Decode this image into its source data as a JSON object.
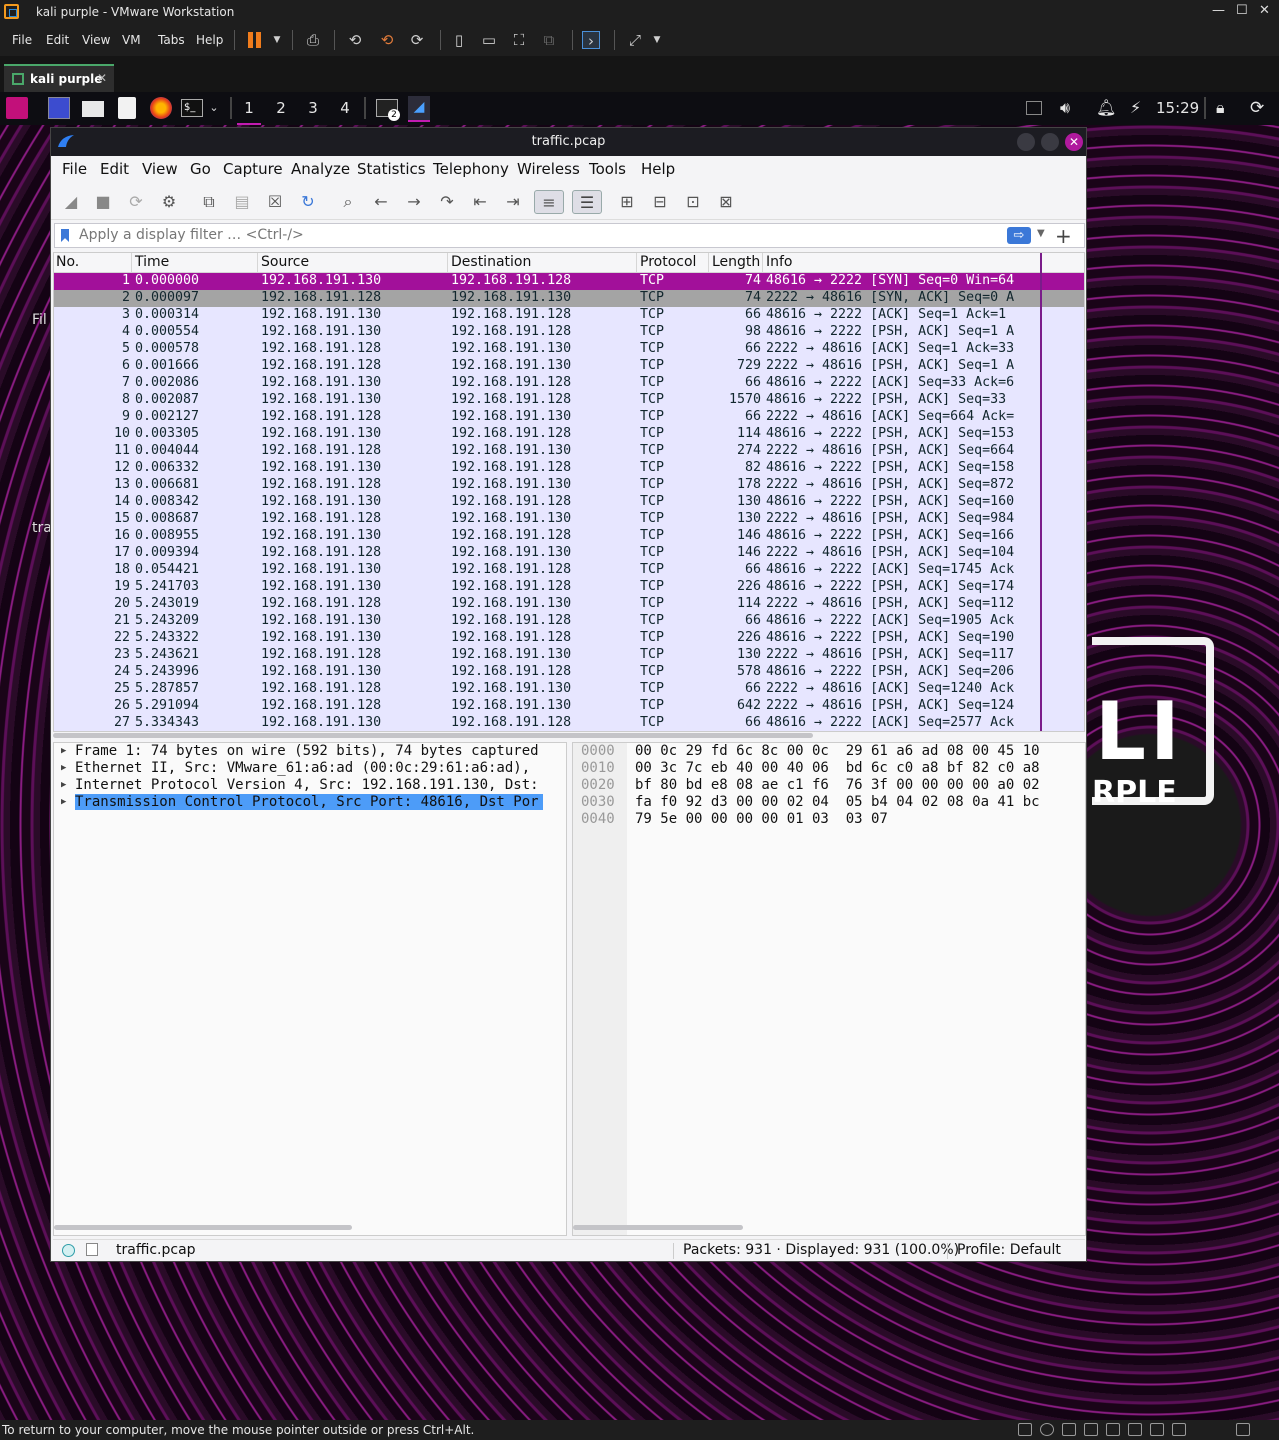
{
  "vm": {
    "title": "kali purple - VMware Workstation",
    "menu": [
      "File",
      "Edit",
      "View",
      "VM",
      "Tabs",
      "Help"
    ],
    "tab_label": "kali purple",
    "status_message": "To return to your computer, move the mouse pointer outside or press Ctrl+Alt."
  },
  "kali_panel": {
    "workspaces": [
      "1",
      "2",
      "3",
      "4"
    ],
    "terminal_badge": "2",
    "clock": "15:29"
  },
  "desktop": {
    "label_1": "Fil",
    "label_2": "tra",
    "logo_fragment": "LI",
    "logo_subtext": "RPLE"
  },
  "wireshark": {
    "title": "traffic.pcap",
    "menu": [
      "File",
      "Edit",
      "View",
      "Go",
      "Capture",
      "Analyze",
      "Statistics",
      "Telephony",
      "Wireless",
      "Tools",
      "Help"
    ],
    "filter_placeholder": "Apply a display filter … <Ctrl-/>",
    "columns": [
      "No.",
      "Time",
      "Source",
      "Destination",
      "Protocol",
      "Length",
      "Info"
    ],
    "packets": [
      {
        "no": "1",
        "time": "0.000000",
        "src": "192.168.191.130",
        "dst": "192.168.191.128",
        "proto": "TCP",
        "len": "74",
        "info": "48616 → 2222 [SYN] Seq=0 Win=64"
      },
      {
        "no": "2",
        "time": "0.000097",
        "src": "192.168.191.128",
        "dst": "192.168.191.130",
        "proto": "TCP",
        "len": "74",
        "info": "2222 → 48616 [SYN, ACK] Seq=0 A"
      },
      {
        "no": "3",
        "time": "0.000314",
        "src": "192.168.191.130",
        "dst": "192.168.191.128",
        "proto": "TCP",
        "len": "66",
        "info": "48616 → 2222 [ACK] Seq=1 Ack=1"
      },
      {
        "no": "4",
        "time": "0.000554",
        "src": "192.168.191.130",
        "dst": "192.168.191.128",
        "proto": "TCP",
        "len": "98",
        "info": "48616 → 2222 [PSH, ACK] Seq=1 A"
      },
      {
        "no": "5",
        "time": "0.000578",
        "src": "192.168.191.128",
        "dst": "192.168.191.130",
        "proto": "TCP",
        "len": "66",
        "info": "2222 → 48616 [ACK] Seq=1 Ack=33"
      },
      {
        "no": "6",
        "time": "0.001666",
        "src": "192.168.191.128",
        "dst": "192.168.191.130",
        "proto": "TCP",
        "len": "729",
        "info": "2222 → 48616 [PSH, ACK] Seq=1 A"
      },
      {
        "no": "7",
        "time": "0.002086",
        "src": "192.168.191.130",
        "dst": "192.168.191.128",
        "proto": "TCP",
        "len": "66",
        "info": "48616 → 2222 [ACK] Seq=33 Ack=6"
      },
      {
        "no": "8",
        "time": "0.002087",
        "src": "192.168.191.130",
        "dst": "192.168.191.128",
        "proto": "TCP",
        "len": "1570",
        "info": "48616 → 2222 [PSH, ACK] Seq=33"
      },
      {
        "no": "9",
        "time": "0.002127",
        "src": "192.168.191.128",
        "dst": "192.168.191.130",
        "proto": "TCP",
        "len": "66",
        "info": "2222 → 48616 [ACK] Seq=664 Ack="
      },
      {
        "no": "10",
        "time": "0.003305",
        "src": "192.168.191.130",
        "dst": "192.168.191.128",
        "proto": "TCP",
        "len": "114",
        "info": "48616 → 2222 [PSH, ACK] Seq=153"
      },
      {
        "no": "11",
        "time": "0.004044",
        "src": "192.168.191.128",
        "dst": "192.168.191.130",
        "proto": "TCP",
        "len": "274",
        "info": "2222 → 48616 [PSH, ACK] Seq=664"
      },
      {
        "no": "12",
        "time": "0.006332",
        "src": "192.168.191.130",
        "dst": "192.168.191.128",
        "proto": "TCP",
        "len": "82",
        "info": "48616 → 2222 [PSH, ACK] Seq=158"
      },
      {
        "no": "13",
        "time": "0.006681",
        "src": "192.168.191.128",
        "dst": "192.168.191.130",
        "proto": "TCP",
        "len": "178",
        "info": "2222 → 48616 [PSH, ACK] Seq=872"
      },
      {
        "no": "14",
        "time": "0.008342",
        "src": "192.168.191.130",
        "dst": "192.168.191.128",
        "proto": "TCP",
        "len": "130",
        "info": "48616 → 2222 [PSH, ACK] Seq=160"
      },
      {
        "no": "15",
        "time": "0.008687",
        "src": "192.168.191.128",
        "dst": "192.168.191.130",
        "proto": "TCP",
        "len": "130",
        "info": "2222 → 48616 [PSH, ACK] Seq=984"
      },
      {
        "no": "16",
        "time": "0.008955",
        "src": "192.168.191.130",
        "dst": "192.168.191.128",
        "proto": "TCP",
        "len": "146",
        "info": "48616 → 2222 [PSH, ACK] Seq=166"
      },
      {
        "no": "17",
        "time": "0.009394",
        "src": "192.168.191.128",
        "dst": "192.168.191.130",
        "proto": "TCP",
        "len": "146",
        "info": "2222 → 48616 [PSH, ACK] Seq=104"
      },
      {
        "no": "18",
        "time": "0.054421",
        "src": "192.168.191.130",
        "dst": "192.168.191.128",
        "proto": "TCP",
        "len": "66",
        "info": "48616 → 2222 [ACK] Seq=1745 Ack"
      },
      {
        "no": "19",
        "time": "5.241703",
        "src": "192.168.191.130",
        "dst": "192.168.191.128",
        "proto": "TCP",
        "len": "226",
        "info": "48616 → 2222 [PSH, ACK] Seq=174"
      },
      {
        "no": "20",
        "time": "5.243019",
        "src": "192.168.191.128",
        "dst": "192.168.191.130",
        "proto": "TCP",
        "len": "114",
        "info": "2222 → 48616 [PSH, ACK] Seq=112"
      },
      {
        "no": "21",
        "time": "5.243209",
        "src": "192.168.191.130",
        "dst": "192.168.191.128",
        "proto": "TCP",
        "len": "66",
        "info": "48616 → 2222 [ACK] Seq=1905 Ack"
      },
      {
        "no": "22",
        "time": "5.243322",
        "src": "192.168.191.130",
        "dst": "192.168.191.128",
        "proto": "TCP",
        "len": "226",
        "info": "48616 → 2222 [PSH, ACK] Seq=190"
      },
      {
        "no": "23",
        "time": "5.243621",
        "src": "192.168.191.128",
        "dst": "192.168.191.130",
        "proto": "TCP",
        "len": "130",
        "info": "2222 → 48616 [PSH, ACK] Seq=117"
      },
      {
        "no": "24",
        "time": "5.243996",
        "src": "192.168.191.130",
        "dst": "192.168.191.128",
        "proto": "TCP",
        "len": "578",
        "info": "48616 → 2222 [PSH, ACK] Seq=206"
      },
      {
        "no": "25",
        "time": "5.287857",
        "src": "192.168.191.128",
        "dst": "192.168.191.130",
        "proto": "TCP",
        "len": "66",
        "info": "2222 → 48616 [ACK] Seq=1240 Ack"
      },
      {
        "no": "26",
        "time": "5.291094",
        "src": "192.168.191.128",
        "dst": "192.168.191.130",
        "proto": "TCP",
        "len": "642",
        "info": "2222 → 48616 [PSH, ACK] Seq=124"
      },
      {
        "no": "27",
        "time": "5.334343",
        "src": "192.168.191.130",
        "dst": "192.168.191.128",
        "proto": "TCP",
        "len": "66",
        "info": "48616 → 2222 [ACK] Seq=2577 Ack"
      }
    ],
    "details": [
      "Frame 1: 74 bytes on wire (592 bits), 74 bytes captured",
      "Ethernet II, Src: VMware_61:a6:ad (00:0c:29:61:a6:ad), ",
      "Internet Protocol Version 4, Src: 192.168.191.130, Dst:",
      "Transmission Control Protocol, Src Port: 48616, Dst Por"
    ],
    "bytes": [
      {
        "off": "0000",
        "hex": "00 0c 29 fd 6c 8c 00 0c  29 61 a6 ad 08 00 45 10"
      },
      {
        "off": "0010",
        "hex": "00 3c 7c eb 40 00 40 06  bd 6c c0 a8 bf 82 c0 a8"
      },
      {
        "off": "0020",
        "hex": "bf 80 bd e8 08 ae c1 f6  76 3f 00 00 00 00 a0 02"
      },
      {
        "off": "0030",
        "hex": "fa f0 92 d3 00 00 02 04  05 b4 04 02 08 0a 41 bc"
      },
      {
        "off": "0040",
        "hex": "79 5e 00 00 00 00 01 03  03 07"
      }
    ],
    "status": {
      "file": "traffic.pcap",
      "packets": "Packets: 931 · Displayed: 931 (100.0%)",
      "profile": "Profile: Default"
    }
  },
  "colors": {
    "selected_row": "#a2109a",
    "tcp_row": "#e7e6ff",
    "selected_detail": "#4d9cf8",
    "accent": "#b01a9e"
  }
}
